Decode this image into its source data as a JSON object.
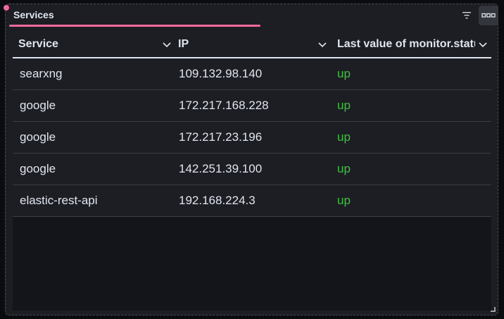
{
  "panel": {
    "title": "Services",
    "accent_color": "#f06aa0",
    "filter_icon": "filter-icon",
    "more_icon": "more-horizontal-icon"
  },
  "table": {
    "columns": [
      {
        "label": "Service",
        "icon": "chevron-down-icon"
      },
      {
        "label": "IP",
        "icon": "chevron-down-icon"
      },
      {
        "label": "Last value of monitor.status",
        "icon": "chevron-down-icon"
      }
    ],
    "rows": [
      {
        "service": "searxng",
        "ip": "109.132.98.140",
        "status": "up"
      },
      {
        "service": "google",
        "ip": "172.217.168.228",
        "status": "up"
      },
      {
        "service": "google",
        "ip": "172.217.23.196",
        "status": "up"
      },
      {
        "service": "google",
        "ip": "142.251.39.100",
        "status": "up"
      },
      {
        "service": "elastic-rest-api",
        "ip": "192.168.224.3",
        "status": "up"
      }
    ],
    "status_color": "#3fc13f"
  }
}
